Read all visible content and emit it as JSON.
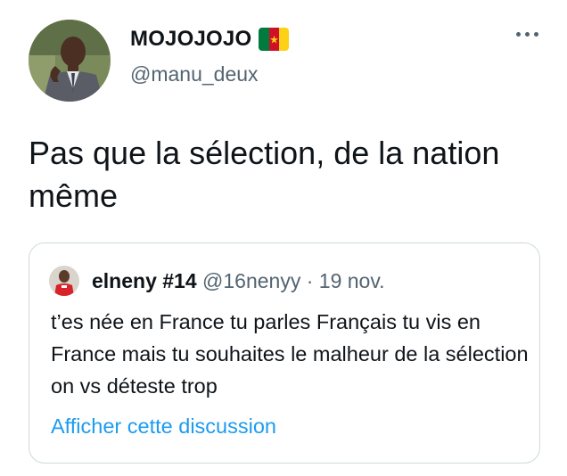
{
  "author": {
    "display_name": "MOJOJOJO",
    "handle": "@manu_deux",
    "flag_icon": "cameroon-flag-icon",
    "avatar_icon": "profile-photo-man-in-suit"
  },
  "more_icon": "more-options-icon",
  "tweet": {
    "text": "Pas que la sélection, de la nation même"
  },
  "quoted_tweet": {
    "display_name": "elneny #14",
    "handle": "@16nenyy",
    "separator": "·",
    "date": "19 nov.",
    "text": "t’es née en France tu parles Français tu vis en France mais tu souhaites le malheur de la sélection on vs déteste trop",
    "link_label": "Afficher cette discussion"
  },
  "colors": {
    "text_primary": "#0f1419",
    "text_secondary": "#536471",
    "link": "#1d9bf0",
    "border": "#cfd9de",
    "flag_green": "#007a3d",
    "flag_red": "#ce1126",
    "flag_yellow": "#fcd116"
  }
}
